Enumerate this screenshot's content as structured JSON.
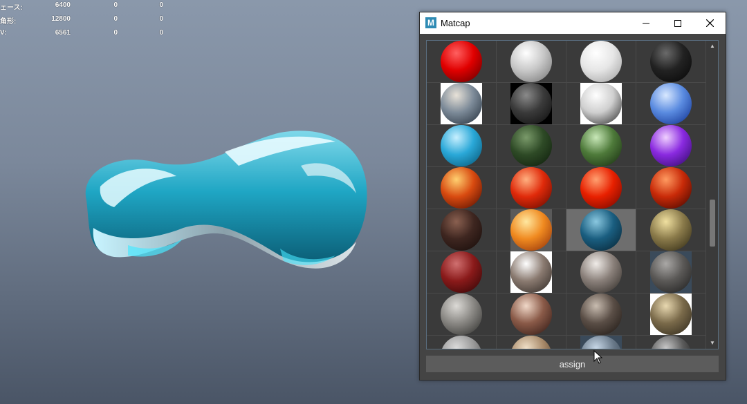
{
  "hud": {
    "rows": [
      {
        "label": "ェース:",
        "v1": "6400",
        "v2": "0",
        "v3": "0"
      },
      {
        "label": "角形:",
        "v1": "12800",
        "v2": "0",
        "v3": "0"
      },
      {
        "label": "V:",
        "v1": "6561",
        "v2": "0",
        "v3": "0"
      }
    ]
  },
  "window": {
    "title": "Matcap",
    "app_icon_letter": "M",
    "minimize_icon": "minimize-icon",
    "maximize_icon": "maximize-icon",
    "close_icon": "close-icon"
  },
  "matcaps": [
    {
      "name": "red-gloss",
      "bg": "#3a3a3a",
      "hi": "#ff6060",
      "mid": "#e00000",
      "lo": "#5a0000"
    },
    {
      "name": "white-silver",
      "bg": "#3a3a3a",
      "hi": "#ffffff",
      "mid": "#c8c8c8",
      "lo": "#707070"
    },
    {
      "name": "white-soft",
      "bg": "#3a3a3a",
      "hi": "#ffffff",
      "mid": "#e6e6e6",
      "lo": "#9a9a9a"
    },
    {
      "name": "black-gloss",
      "bg": "#3a3a3a",
      "hi": "#6a6a6a",
      "mid": "#222222",
      "lo": "#050505"
    },
    {
      "name": "grey-blue-metal",
      "bg": "#ffffff",
      "hi": "#e8e2d8",
      "mid": "#7c8a98",
      "lo": "#1f2a36"
    },
    {
      "name": "dark-grey",
      "bg": "#000000",
      "hi": "#8a8a8a",
      "mid": "#3a3a3a",
      "lo": "#0a0a0a"
    },
    {
      "name": "white-black-ring",
      "bg": "#ffffff",
      "hi": "#ffffff",
      "mid": "#cfcfcf",
      "lo": "#222222"
    },
    {
      "name": "blue-chrome",
      "bg": "#3a3a3a",
      "hi": "#d8e8ff",
      "mid": "#5a8be0",
      "lo": "#0a2a8a"
    },
    {
      "name": "cyan-gloss",
      "bg": "#3a3a3a",
      "hi": "#c8f0ff",
      "mid": "#2aa8d8",
      "lo": "#05506e"
    },
    {
      "name": "dark-green",
      "bg": "#3a3a3a",
      "hi": "#7a9a6a",
      "mid": "#2e4a26",
      "lo": "#0c1a0a"
    },
    {
      "name": "green-gloss",
      "bg": "#3a3a3a",
      "hi": "#c8e8b8",
      "mid": "#4e7a3a",
      "lo": "#14280e"
    },
    {
      "name": "purple-chrome",
      "bg": "#3a3a3a",
      "hi": "#f0d0ff",
      "mid": "#8a2ae0",
      "lo": "#2a0860"
    },
    {
      "name": "orange-lava",
      "bg": "#3a3a3a",
      "hi": "#ffd070",
      "mid": "#d84a10",
      "lo": "#4a0a00"
    },
    {
      "name": "red-orange-gloss",
      "bg": "#3a3a3a",
      "hi": "#ffb080",
      "mid": "#e02a0a",
      "lo": "#5a0800"
    },
    {
      "name": "red-ember",
      "bg": "#3a3a3a",
      "hi": "#ffa070",
      "mid": "#e82000",
      "lo": "#6a0600"
    },
    {
      "name": "red-crackle",
      "bg": "#3a3a3a",
      "hi": "#ff9a60",
      "mid": "#c82a08",
      "lo": "#3a0400"
    },
    {
      "name": "dark-brown",
      "bg": "#3a3a3a",
      "hi": "#8a6050",
      "mid": "#3e2620",
      "lo": "#140a08"
    },
    {
      "name": "orange-soft",
      "bg": "#5a5a5a",
      "hi": "#ffe8a0",
      "mid": "#f08a20",
      "lo": "#8a2a08"
    },
    {
      "name": "teal-blue",
      "bg": "#6e6e6e",
      "hi": "#8ac8e0",
      "mid": "#1a5e80",
      "lo": "#06202e"
    },
    {
      "name": "gold-olive",
      "bg": "#3a3a3a",
      "hi": "#f0e0a0",
      "mid": "#8a7a4a",
      "lo": "#2a2410"
    },
    {
      "name": "dark-red",
      "bg": "#3a3a3a",
      "hi": "#d07070",
      "mid": "#8a1a1a",
      "lo": "#2a0404"
    },
    {
      "name": "grey-bright-rim",
      "bg": "#ffffff",
      "hi": "#ffffff",
      "mid": "#8a7a70",
      "lo": "#2a2420"
    },
    {
      "name": "grey-taupe",
      "bg": "#3a3a3a",
      "hi": "#f0ece8",
      "mid": "#8a807a",
      "lo": "#2a2622"
    },
    {
      "name": "grey-slate",
      "bg": "#3a4a5a",
      "hi": "#aaa8a6",
      "mid": "#5a5856",
      "lo": "#1a1a1a"
    },
    {
      "name": "grey-stone",
      "bg": "#3a3a3a",
      "hi": "#dcdad6",
      "mid": "#8a8884",
      "lo": "#2a2a28"
    },
    {
      "name": "brown-skin",
      "bg": "#3a3a3a",
      "hi": "#f0d8c8",
      "mid": "#8a5a48",
      "lo": "#2a1410"
    },
    {
      "name": "dark-taupe",
      "bg": "#3a3a3a",
      "hi": "#c8bcb0",
      "mid": "#5a4e46",
      "lo": "#1a1410"
    },
    {
      "name": "tan-rim",
      "bg": "#ffffff",
      "hi": "#e8d8b0",
      "mid": "#7a6a4a",
      "lo": "#2a2418"
    },
    {
      "name": "grey-light",
      "bg": "#3a3a3a",
      "hi": "#dcdcdc",
      "mid": "#9a9a9a",
      "lo": "#3a3a3a"
    },
    {
      "name": "tan-light",
      "bg": "#3a3a3a",
      "hi": "#f0e0c8",
      "mid": "#a88a6a",
      "lo": "#3a2a1a"
    },
    {
      "name": "blue-grey",
      "bg": "#3a4a5a",
      "hi": "#c8d8e8",
      "mid": "#6a7a8a",
      "lo": "#2a3440"
    },
    {
      "name": "dark-silver",
      "bg": "#3a3a3a",
      "hi": "#c8c8c8",
      "mid": "#5a5a5a",
      "lo": "#101010"
    }
  ],
  "selected_index": 18,
  "assign_label": "assign",
  "mesh_colors": {
    "primary": "#1fa6c4",
    "highlight": "#e8fbff",
    "dark": "#0a5a72"
  }
}
